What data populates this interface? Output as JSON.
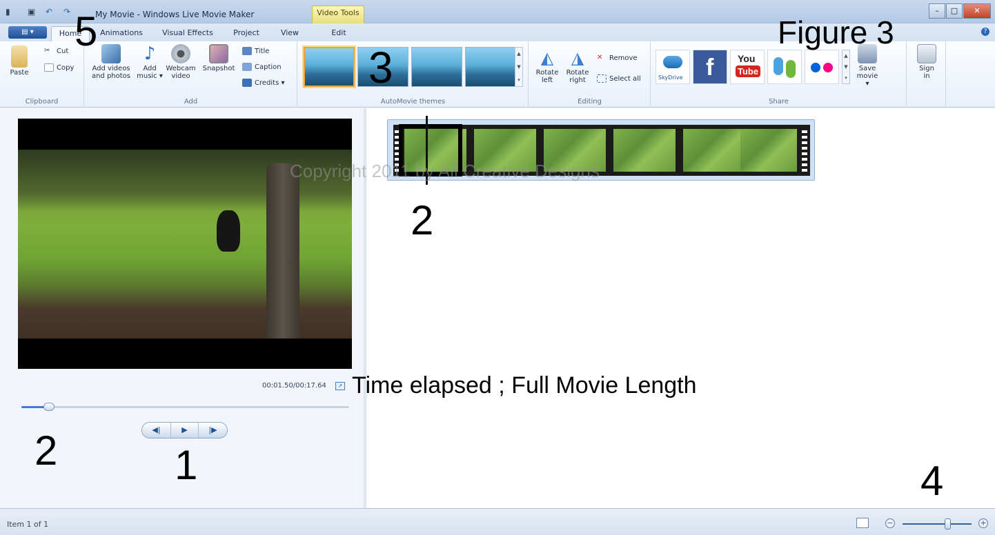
{
  "window": {
    "title": "My Movie - Windows Live Movie Maker",
    "context_tab": "Video Tools",
    "controls": {
      "minimize": "–",
      "maximize": "□",
      "close": "✕"
    }
  },
  "tabs": [
    {
      "label": "Home",
      "selected": true
    },
    {
      "label": "Animations"
    },
    {
      "label": "Visual Effects"
    },
    {
      "label": "Project"
    },
    {
      "label": "View"
    },
    {
      "label": "Edit"
    }
  ],
  "ribbon": {
    "clipboard": {
      "label": "Clipboard",
      "paste": "Paste",
      "cut": "Cut",
      "copy": "Copy"
    },
    "add": {
      "label": "Add",
      "add_videos": [
        "Add videos",
        "and photos"
      ],
      "add_music": [
        "Add",
        "music ▾"
      ],
      "webcam": [
        "Webcam",
        "video"
      ],
      "snapshot": "Snapshot",
      "title": "Title",
      "caption": "Caption",
      "credits": "Credits ▾"
    },
    "themes": {
      "label": "AutoMovie themes"
    },
    "editing": {
      "label": "Editing",
      "rotate_left": [
        "Rotate",
        "left"
      ],
      "rotate_right": [
        "Rotate",
        "right"
      ],
      "remove": "Remove",
      "select_all": "Select all"
    },
    "share": {
      "label": "Share",
      "skydrive": "SkyDrive",
      "youtube": [
        "You",
        "Tube"
      ],
      "save_movie": [
        "Save",
        "movie ▾"
      ],
      "sign_in": [
        "Sign",
        "in"
      ]
    }
  },
  "preview": {
    "time_readout": "00:01.50/00:17.64",
    "seek_fraction": 0.085
  },
  "storyboard": {
    "watermark": "Copyright 2011 by All Creative Designs"
  },
  "annotations": {
    "a5": "5",
    "a3": "3",
    "figure": "Figure 3",
    "a2_top": "2",
    "time_note": "Time elapsed ; Full Movie Length",
    "a2_bottom": "2",
    "a1": "1",
    "a4": "4"
  },
  "statusbar": {
    "item_count": "Item 1 of 1",
    "zoom_fraction": 0.65
  },
  "colors": {
    "accent": "#3c7fd1",
    "ribbon_bg": "#e8f0fa",
    "selected_theme": "#e9a33a"
  }
}
